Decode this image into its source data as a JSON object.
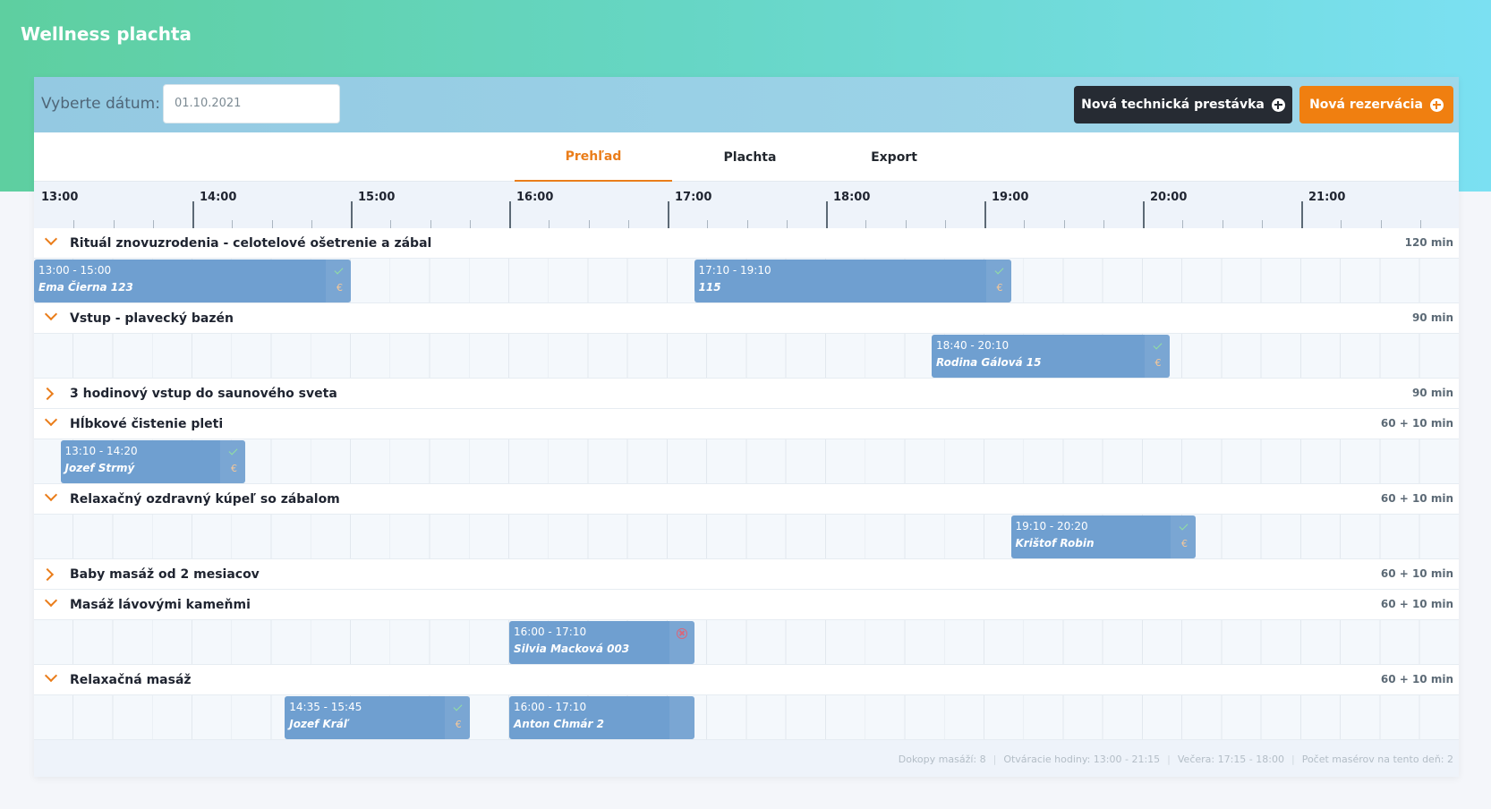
{
  "app": {
    "title": "Wellness plachta"
  },
  "toolbar": {
    "date_label": "Vyberte dátum:",
    "date_value": "01.10.2021",
    "new_break_label": "Nová technická prestávka",
    "new_reservation_label": "Nová rezervácia"
  },
  "tabs": [
    {
      "label": "Prehľad",
      "active": true
    },
    {
      "label": "Plachta",
      "active": false
    },
    {
      "label": "Export",
      "active": false
    }
  ],
  "timeline": {
    "hours": [
      "13:00",
      "14:00",
      "15:00",
      "16:00",
      "17:00",
      "18:00",
      "19:00",
      "20:00",
      "21:00"
    ]
  },
  "services": [
    {
      "name": "Rituál znovuzrodenia - celotelové ošetrenie a zábal",
      "duration": "120 min",
      "expanded": true,
      "bookings": [
        {
          "time": "13:00 - 15:00",
          "name": "Ema Čierna  123",
          "status": "paid"
        },
        {
          "time": "17:10 - 19:10",
          "name": " 115",
          "status": "paid"
        }
      ]
    },
    {
      "name": "Vstup - plavecký bazén",
      "duration": "90 min",
      "expanded": true,
      "bookings": [
        {
          "time": "18:40 - 20:10",
          "name": "Rodina Gálová  15",
          "status": "paid"
        }
      ]
    },
    {
      "name": "3 hodinový vstup do saunového sveta",
      "duration": "90 min",
      "expanded": false,
      "bookings": []
    },
    {
      "name": "Hĺbkové čistenie pleti",
      "duration": "60 + 10 min",
      "expanded": true,
      "bookings": [
        {
          "time": "13:10 - 14:20",
          "name": "Jozef Strmý",
          "status": "paid"
        }
      ]
    },
    {
      "name": "Relaxačný ozdravný kúpeľ so zábalom",
      "duration": "60 + 10 min",
      "expanded": true,
      "bookings": [
        {
          "time": "19:10 - 20:20",
          "name": "Krištof Robin",
          "status": "paid"
        }
      ]
    },
    {
      "name": "Baby masáž od 2 mesiacov",
      "duration": "60 + 10 min",
      "expanded": false,
      "bookings": []
    },
    {
      "name": "Masáž lávovými kameňmi",
      "duration": "60 + 10 min",
      "expanded": true,
      "bookings": [
        {
          "time": "16:00 - 17:10",
          "name": "Silvia Macková  003",
          "status": "cancelled"
        }
      ]
    },
    {
      "name": "Relaxačná masáž",
      "duration": "60 + 10 min",
      "expanded": true,
      "bookings": [
        {
          "time": "14:35 - 15:45",
          "name": "Jozef Kráľ",
          "status": "paid"
        },
        {
          "time": "16:00 - 17:10",
          "name": "Anton Chmár  2",
          "status": "none"
        }
      ]
    }
  ],
  "footer": {
    "total": "Dokopy masáží: 8",
    "opening": "Otváracie hodiny: 13:00 - 21:15",
    "dinner": "Večera: 17:15 - 18:00",
    "masseurs": "Počet masérov na tento deň: 2"
  },
  "colors": {
    "accent": "#ea7d1a",
    "booking": "#6f9fd0",
    "dark_button": "#262b33",
    "orange_button": "#f07f10"
  }
}
